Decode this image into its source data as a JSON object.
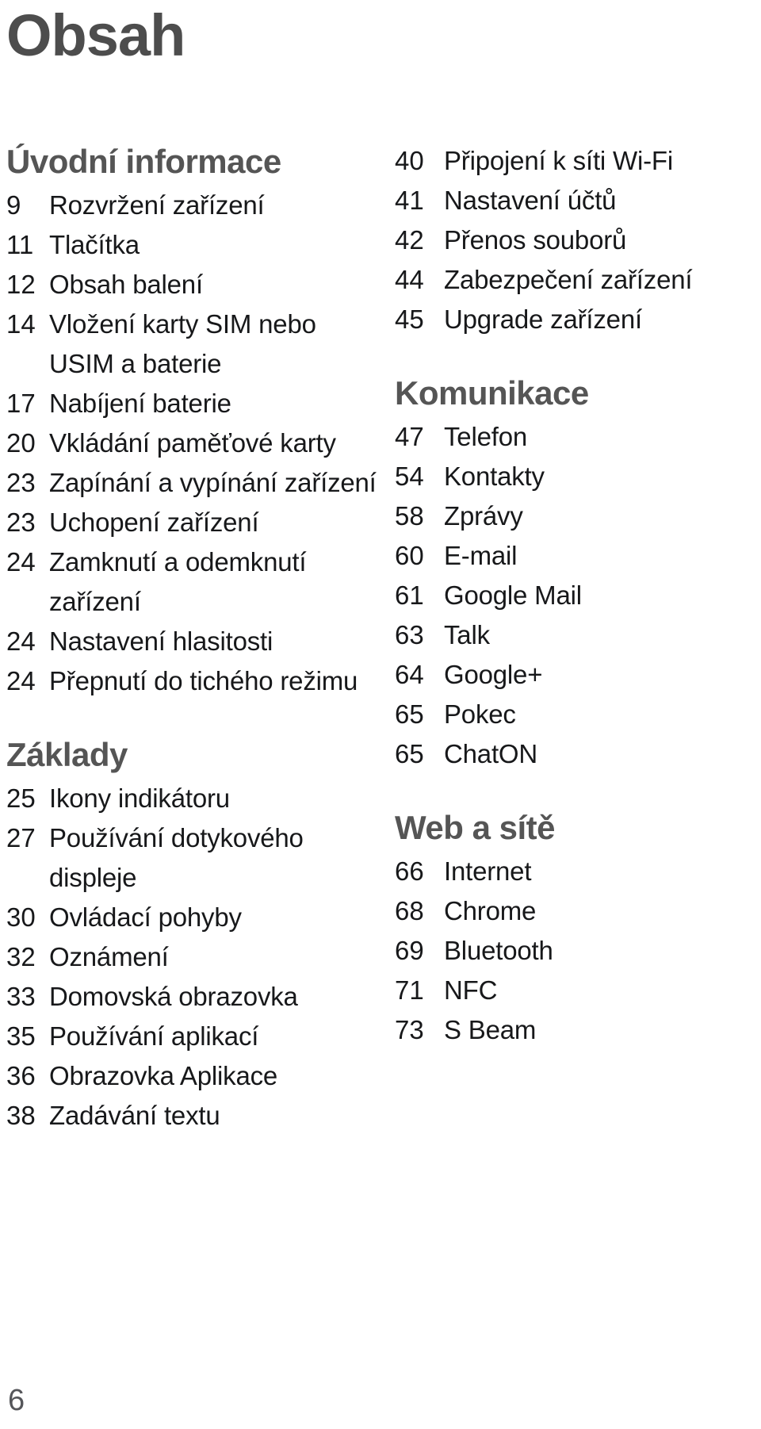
{
  "document": {
    "title": "Obsah",
    "folio": "6"
  },
  "columns": {
    "left": [
      {
        "heading": "Úvodní informace",
        "entries": [
          {
            "page": "9",
            "label": "Rozvržení zařízení"
          },
          {
            "page": "11",
            "label": "Tlačítka"
          },
          {
            "page": "12",
            "label": "Obsah balení"
          },
          {
            "page": "14",
            "label": "Vložení karty SIM nebo USIM a baterie"
          },
          {
            "page": "17",
            "label": "Nabíjení baterie"
          },
          {
            "page": "20",
            "label": "Vkládání paměťové karty"
          },
          {
            "page": "23",
            "label": "Zapínání a vypínání zařízení"
          },
          {
            "page": "23",
            "label": "Uchopení zařízení"
          },
          {
            "page": "24",
            "label": "Zamknutí a odemknutí zařízení"
          },
          {
            "page": "24",
            "label": "Nastavení hlasitosti"
          },
          {
            "page": "24",
            "label": "Přepnutí do tichého režimu"
          }
        ]
      },
      {
        "heading": "Základy",
        "entries": [
          {
            "page": "25",
            "label": "Ikony indikátoru"
          },
          {
            "page": "27",
            "label": "Používání dotykového displeje"
          },
          {
            "page": "30",
            "label": "Ovládací pohyby"
          },
          {
            "page": "32",
            "label": "Oznámení"
          },
          {
            "page": "33",
            "label": "Domovská obrazovka"
          },
          {
            "page": "35",
            "label": "Používání aplikací"
          },
          {
            "page": "36",
            "label": "Obrazovka Aplikace"
          },
          {
            "page": "38",
            "label": "Zadávání textu"
          }
        ]
      }
    ],
    "right": [
      {
        "heading": "",
        "entries": [
          {
            "page": "40",
            "label": "Připojení k síti Wi-Fi"
          },
          {
            "page": "41",
            "label": "Nastavení účtů"
          },
          {
            "page": "42",
            "label": "Přenos souborů"
          },
          {
            "page": "44",
            "label": "Zabezpečení zařízení"
          },
          {
            "page": "45",
            "label": "Upgrade zařízení"
          }
        ]
      },
      {
        "heading": "Komunikace",
        "entries": [
          {
            "page": "47",
            "label": "Telefon"
          },
          {
            "page": "54",
            "label": "Kontakty"
          },
          {
            "page": "58",
            "label": "Zprávy"
          },
          {
            "page": "60",
            "label": "E-mail"
          },
          {
            "page": "61",
            "label": "Google Mail"
          },
          {
            "page": "63",
            "label": "Talk"
          },
          {
            "page": "64",
            "label": "Google+"
          },
          {
            "page": "65",
            "label": "Pokec"
          },
          {
            "page": "65",
            "label": "ChatON"
          }
        ]
      },
      {
        "heading": "Web a sítě",
        "entries": [
          {
            "page": "66",
            "label": "Internet"
          },
          {
            "page": "68",
            "label": "Chrome"
          },
          {
            "page": "69",
            "label": "Bluetooth"
          },
          {
            "page": "71",
            "label": "NFC"
          },
          {
            "page": "73",
            "label": "S Beam"
          }
        ]
      }
    ]
  }
}
